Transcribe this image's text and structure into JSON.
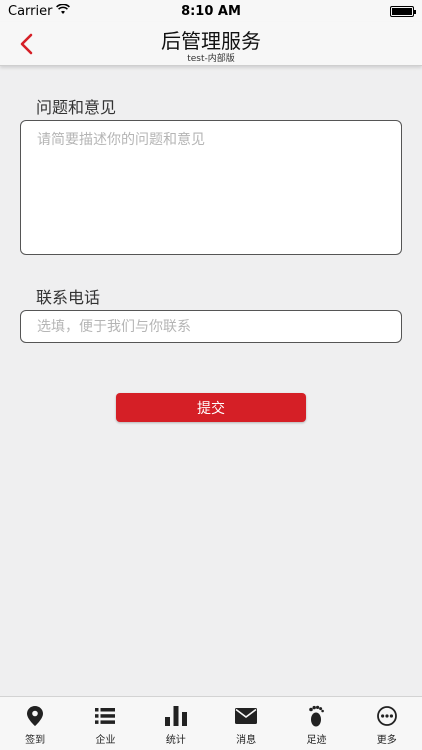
{
  "status_bar": {
    "carrier": "Carrier",
    "time": "8:10 AM"
  },
  "nav": {
    "title": "后管理服务",
    "subtitle": "test-内部版"
  },
  "form": {
    "question_label": "问题和意见",
    "question_placeholder": "请简要描述你的问题和意见",
    "phone_label": "联系电话",
    "phone_placeholder": "选填，便于我们与你联系",
    "submit_label": "提交"
  },
  "tabs": [
    {
      "label": "签到",
      "icon": "location-pin-icon"
    },
    {
      "label": "企业",
      "icon": "list-icon"
    },
    {
      "label": "统计",
      "icon": "bar-chart-icon"
    },
    {
      "label": "消息",
      "icon": "envelope-icon"
    },
    {
      "label": "足迹",
      "icon": "footprint-icon"
    },
    {
      "label": "更多",
      "icon": "more-icon"
    }
  ],
  "colors": {
    "accent": "#d51f26",
    "background": "#efeff0",
    "bar": "#f7f7f7"
  }
}
